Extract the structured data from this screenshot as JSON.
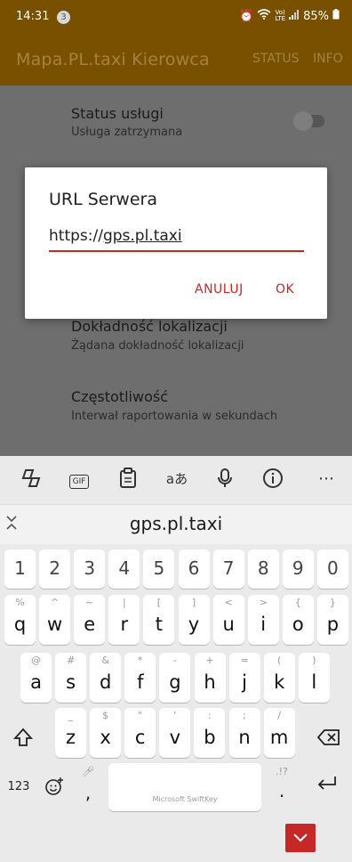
{
  "status_bar": {
    "time": "14:31",
    "notification_count": "3",
    "icons": [
      "alarm-icon",
      "wifi-icon",
      "volte-icon",
      "signal-icon"
    ],
    "battery": "85%"
  },
  "app_bar": {
    "title": "Mapa.PL.taxi Kierowca",
    "actions": [
      "STATUS",
      "INFO"
    ]
  },
  "settings": [
    {
      "title": "Status usługi",
      "subtitle": "Usługa zatrzymana",
      "toggle": false
    },
    {
      "title": "Dokładność lokalizacji",
      "subtitle": "Żądana dokładność lokalizacji"
    },
    {
      "title": "Częstotliwość",
      "subtitle": "Interwał raportowania w sekundach"
    }
  ],
  "dialog": {
    "title": "URL Serwera",
    "value": "https://gps.pl.taxi",
    "cancel": "ANULUJ",
    "ok": "OK"
  },
  "keyboard": {
    "toolbar": [
      "copilot-icon",
      "gif-icon",
      "clipboard-icon",
      "translate-icon",
      "microphone-icon",
      "info-icon"
    ],
    "gif_label": "GIF",
    "translate_label": "aあ",
    "suggestion": "gps.pl.taxi",
    "numbers": [
      "1",
      "2",
      "3",
      "4",
      "5",
      "6",
      "7",
      "8",
      "9",
      "0"
    ],
    "row1": [
      {
        "key": "q",
        "hint": "%"
      },
      {
        "key": "w",
        "hint": "^"
      },
      {
        "key": "e",
        "hint": "~"
      },
      {
        "key": "r",
        "hint": "|"
      },
      {
        "key": "t",
        "hint": "["
      },
      {
        "key": "y",
        "hint": "]"
      },
      {
        "key": "u",
        "hint": "<"
      },
      {
        "key": "i",
        "hint": ">"
      },
      {
        "key": "o",
        "hint": "{"
      },
      {
        "key": "p",
        "hint": "}"
      }
    ],
    "row2": [
      {
        "key": "a",
        "hint": "@"
      },
      {
        "key": "s",
        "hint": "#"
      },
      {
        "key": "d",
        "hint": "&"
      },
      {
        "key": "f",
        "hint": "*"
      },
      {
        "key": "g",
        "hint": "-"
      },
      {
        "key": "h",
        "hint": "+"
      },
      {
        "key": "j",
        "hint": "="
      },
      {
        "key": "k",
        "hint": "("
      },
      {
        "key": "l",
        "hint": ")"
      }
    ],
    "row3": [
      {
        "key": "z",
        "hint": "_"
      },
      {
        "key": "x",
        "hint": "$"
      },
      {
        "key": "c",
        "hint": "\""
      },
      {
        "key": "v",
        "hint": "'"
      },
      {
        "key": "b",
        "hint": ":"
      },
      {
        "key": "n",
        "hint": ";"
      },
      {
        "key": "m",
        "hint": "/"
      }
    ],
    "symbols_key": "123",
    "comma_key": ",",
    "space_label": "Microsoft SwiftKey",
    "punct_hint": ".!?",
    "period_key": "."
  }
}
